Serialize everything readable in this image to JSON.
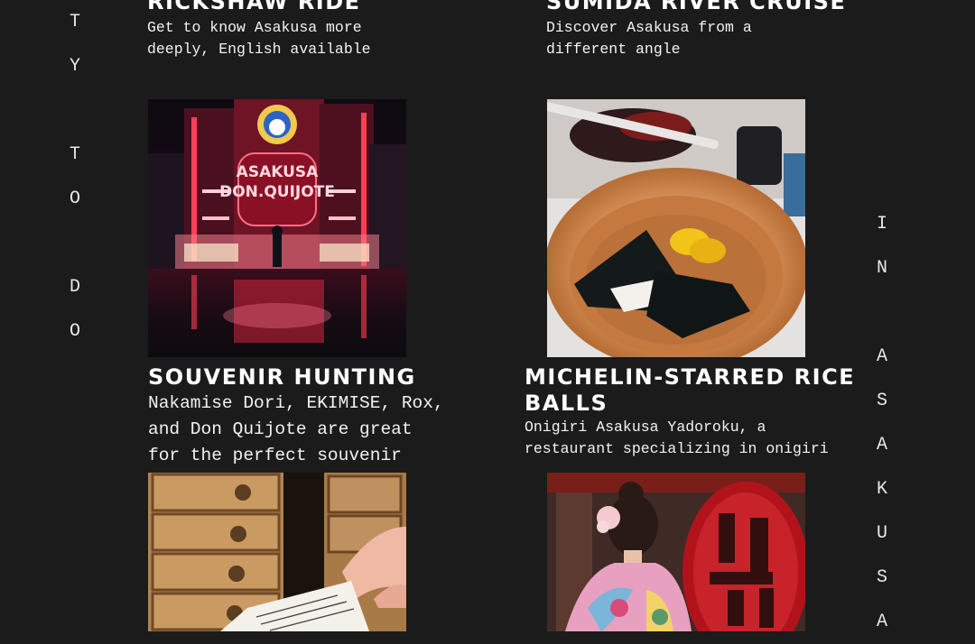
{
  "left_vertical": [
    "T",
    "Y",
    "",
    "T",
    "O",
    "",
    "D",
    "O"
  ],
  "right_vertical": [
    "I",
    "N",
    "",
    "A",
    "S",
    "A",
    "K",
    "U",
    "S",
    "A"
  ],
  "cards": [
    {
      "title": "RICKSHAW RIDE",
      "description": "Get to know Asakusa more\ndeeply, English available"
    },
    {
      "title": "SUMIDA RIVER CRUISE",
      "description": "Discover Asakusa from a\ndifferent angle"
    },
    {
      "title": "SOUVENIR HUNTING",
      "description": "Nakamise Dori, EKIMISE, Rox,\nand Don Quijote are great\nfor the perfect souvenir"
    },
    {
      "title": "MICHELIN-STARRED RICE\nBALLS",
      "description": "Onigiri Asakusa Yadoroku, a\nrestaurant specializing in onigiri"
    }
  ],
  "photos": {
    "don_quijote_sign": "ASAKUSA\nDON.QUIJOTE"
  },
  "colors": {
    "background": "#1b1b1b",
    "text": "#ffffff"
  }
}
